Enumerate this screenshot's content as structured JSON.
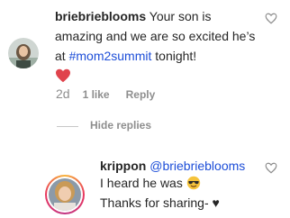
{
  "comment": {
    "username": "briebrieblooms",
    "text_1": " Your son is amazing and we are so excited he’s at ",
    "hashtag": "#mom2summit",
    "text_2": " tonight!",
    "emoji": "red-heart",
    "age": "2d",
    "likes": "1 like",
    "reply_label": "Reply"
  },
  "hide_replies_label": "Hide replies",
  "reply": {
    "username": "krippon",
    "mention": "@briebrieblooms",
    "line_1": "I heard he was",
    "emoji": "smiling-face-with-sunglasses",
    "line_2": "Thanks for sharing- ♥"
  },
  "colors": {
    "hashtag": "#1d4ed8",
    "muted": "#8e8e8e",
    "heart_red": "#e0434c"
  },
  "icons": [
    "like-heart-outline-icon",
    "avatar-photo"
  ]
}
